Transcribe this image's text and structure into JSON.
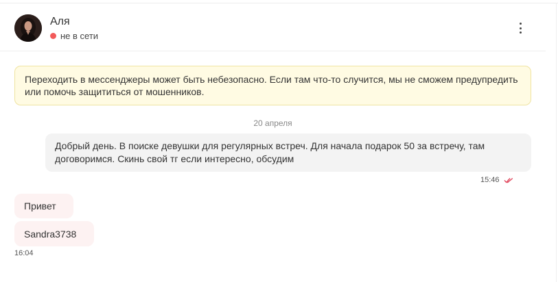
{
  "contact": {
    "name": "Аля",
    "status": "не в сети",
    "status_color": "#f25a5a"
  },
  "menu": {
    "icon": "more-vertical-icon"
  },
  "warning": {
    "text": "Переходить в мессенджеры может быть небезопасно. Если там что-то случится, мы не сможем предупредить или помочь защититься от мошенников."
  },
  "conversation": {
    "date_label": "20 апреля",
    "messages": [
      {
        "direction": "outgoing",
        "text": "Добрый день. В поиске девушки для регулярных встреч. Для начала подарок 50 за встречу, там договоримся. Скинь свой тг если интересно, обсудим",
        "time": "15:46",
        "status_icon": "read-double-check-icon"
      },
      {
        "direction": "incoming",
        "text": "Привет"
      },
      {
        "direction": "incoming",
        "text": "Sandra3738",
        "time": "16:04"
      }
    ]
  },
  "colors": {
    "warning_bg": "#fffbe3",
    "outgoing_bubble": "#f3f3f3",
    "incoming_bubble": "#fdf2f2",
    "read_check": "#e0445a"
  }
}
